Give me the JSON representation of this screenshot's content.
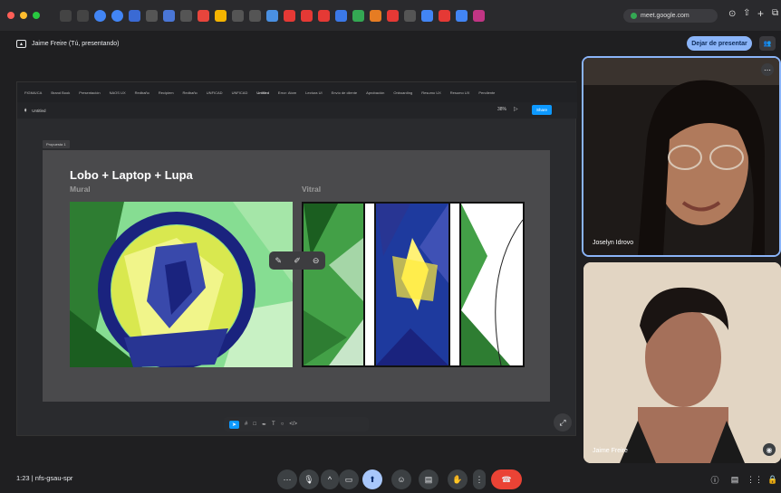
{
  "browser": {
    "url": "meet.google.com"
  },
  "header": {
    "presenting_label": "Jaime Freire (Tú, presentando)",
    "stop_button": "Dejar de presentar"
  },
  "shared_screen": {
    "tabs": [
      "FIGMA/CA",
      "Brand Book",
      "Presentación",
      "NAOS UX",
      "Redbaño",
      "Recipiem",
      "Redbaño",
      "UNFICAD",
      "UNFICAD",
      "Untitled",
      "Error: Atom",
      "Lectura UI",
      "Envío de cliente",
      "Aprobación",
      "Onboarding",
      "Resumo UX",
      "Resumo UX",
      "Pendiente"
    ],
    "file_name": "Untitled",
    "zoom": "38%",
    "share_button": "Share",
    "page_label": "Propuesta 1",
    "board_title": "Lobo + Laptop + Lupa",
    "label_mural": "Mural",
    "label_vitral": "Vitral"
  },
  "participants": [
    {
      "name": "Joselyn Idrovo"
    },
    {
      "name": "Jaime Freire"
    }
  ],
  "footer": {
    "time": "1:23",
    "meeting_code": "nfs-gsau-spr"
  }
}
